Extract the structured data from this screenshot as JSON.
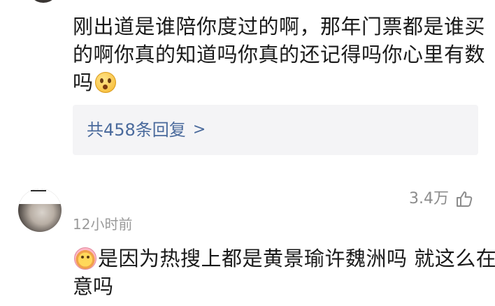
{
  "comment1": {
    "line1": "刚出道是谁陪你度过的啊，那年门票都是谁买",
    "line2": "的啊你真的知道吗你真的还记得吗你心里有数",
    "line3": "吗",
    "emoji": "shocked-face-icon"
  },
  "replies": {
    "label": "共458条回复",
    "chevron": ">"
  },
  "comment2": {
    "timestamp": "12小时前",
    "likes": "3.4万",
    "line1": "是因为热搜上都是黄景瑜许魏洲吗 就这么在",
    "line2": "意吗",
    "emoji": "flower-face-icon"
  }
}
